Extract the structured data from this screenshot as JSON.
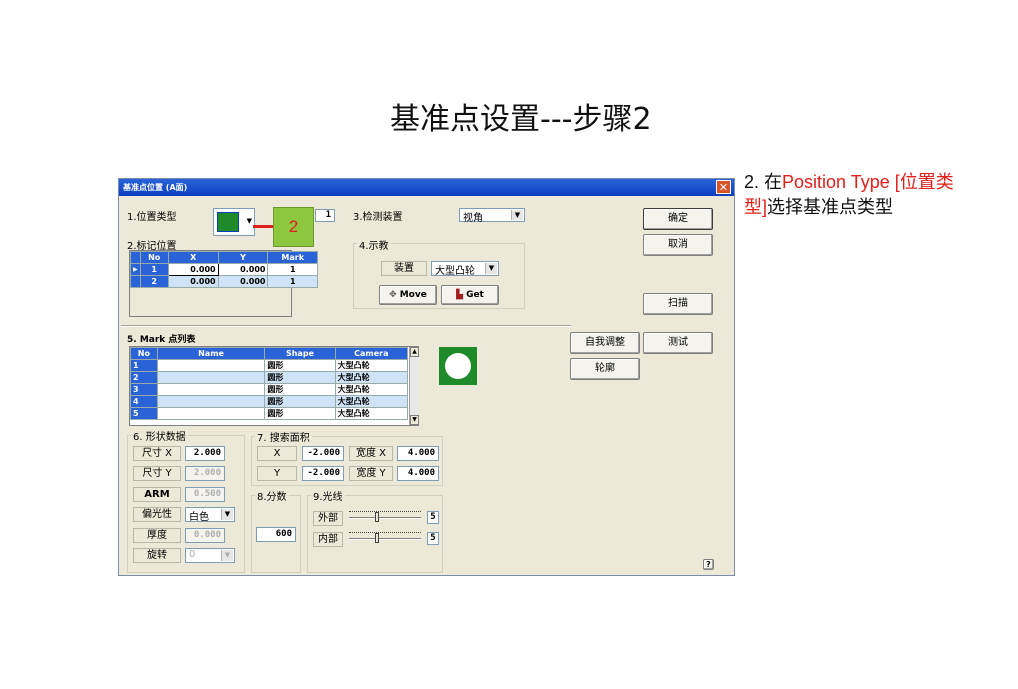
{
  "slide": {
    "title": "基准点设置---步骤2",
    "note_prefix": "2. 在",
    "note_red": "Position Type [位置类型]",
    "note_suffix": "选择基准点类型"
  },
  "dialog": {
    "title": "基准点位置 (A面)",
    "close": "✕",
    "position_type_label": "1.位置类型",
    "callout_number": "2",
    "field_1": "1",
    "detector_label": "3.检测装置",
    "detector_value": "视角",
    "mark_position_label": "2.标记位置",
    "mark_table": {
      "headers": [
        "No",
        "X",
        "Y",
        "Mark"
      ],
      "rows": [
        {
          "no": "1",
          "x": "0.000",
          "y": "0.000",
          "mark": "1"
        },
        {
          "no": "2",
          "x": "0.000",
          "y": "0.000",
          "mark": "1"
        }
      ]
    },
    "teach_label": "4.示教",
    "device_label": "装置",
    "device_value": "大型凸轮",
    "move_button": "Move",
    "get_button": "Get",
    "ok_button": "确定",
    "cancel_button": "取消",
    "scan_button": "扫描",
    "self_adjust_button": "自我调整",
    "test_button": "测试",
    "contour_button": "轮廓",
    "mark_list_label": "5. Mark 点列表",
    "mark_list": {
      "headers": [
        "No",
        "Name",
        "Shape",
        "Camera"
      ],
      "rows": [
        {
          "no": "1",
          "name": "",
          "shape": "圆形",
          "camera": "大型凸轮"
        },
        {
          "no": "2",
          "name": "",
          "shape": "圆形",
          "camera": "大型凸轮"
        },
        {
          "no": "3",
          "name": "",
          "shape": "圆形",
          "camera": "大型凸轮"
        },
        {
          "no": "4",
          "name": "",
          "shape": "圆形",
          "camera": "大型凸轮"
        },
        {
          "no": "5",
          "name": "",
          "shape": "圆形",
          "camera": "大型凸轮"
        }
      ]
    },
    "shape_data_label": "6. 形状数据",
    "size_x_label": "尺寸 X",
    "size_x_value": "2.000",
    "size_y_label": "尺寸 Y",
    "size_y_value": "2.000",
    "arm_label": "ARM",
    "arm_value": "0.500",
    "polarity_label": "偏光性",
    "polarity_value": "白色",
    "thickness_label": "厚度",
    "thickness_value": "0.000",
    "rotation_label": "旋转",
    "rotation_value": "0",
    "search_area_label": "7. 搜索面积",
    "search_x_label": "X",
    "search_x_value": "-2.000",
    "width_x_label": "宽度 X",
    "width_x_value": "4.000",
    "search_y_label": "Y",
    "search_y_value": "-2.000",
    "width_y_label": "宽度 Y",
    "width_y_value": "4.000",
    "score_label": "8.分数",
    "score_value": "600",
    "light_label": "9.光线",
    "outer_label": "外部",
    "outer_value": "5",
    "inner_label": "内部",
    "inner_value": "5",
    "help": "?"
  }
}
